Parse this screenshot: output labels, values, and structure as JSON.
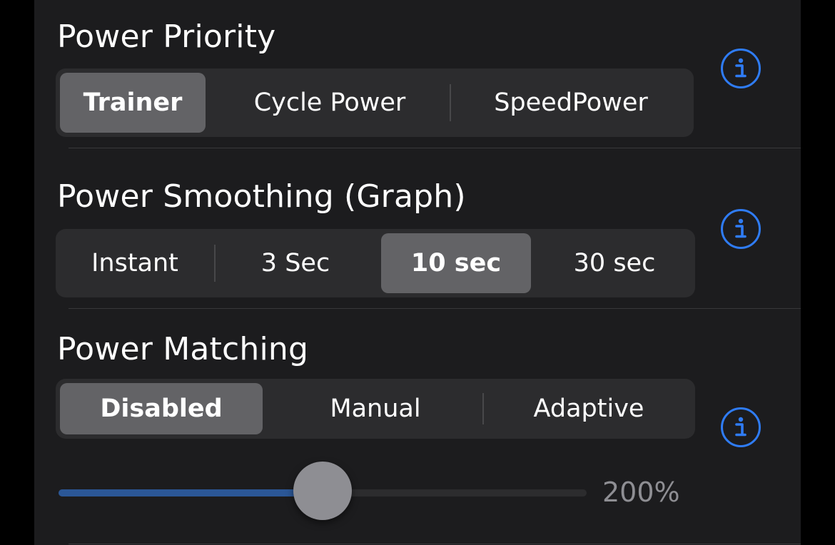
{
  "power_priority": {
    "title": "Power Priority",
    "options": [
      "Trainer",
      "Cycle Power",
      "SpeedPower"
    ],
    "selected": "Trainer"
  },
  "power_smoothing": {
    "title": "Power Smoothing (Graph)",
    "options": [
      "Instant",
      "3 Sec",
      "10 sec",
      "30 sec"
    ],
    "selected": "10 sec"
  },
  "power_matching": {
    "title": "Power Matching",
    "options": [
      "Disabled",
      "Manual",
      "Adaptive"
    ],
    "selected": "Disabled",
    "slider": {
      "value_label": "200%",
      "fraction": 0.5
    }
  },
  "colors": {
    "accent": "#2f7cf6",
    "slider_fill": "#2b5797",
    "panel_bg": "#1c1c1e",
    "segment_bg": "#2c2c2e",
    "segment_selected": "#636366"
  },
  "icons": {
    "info": "info-circle-icon"
  }
}
